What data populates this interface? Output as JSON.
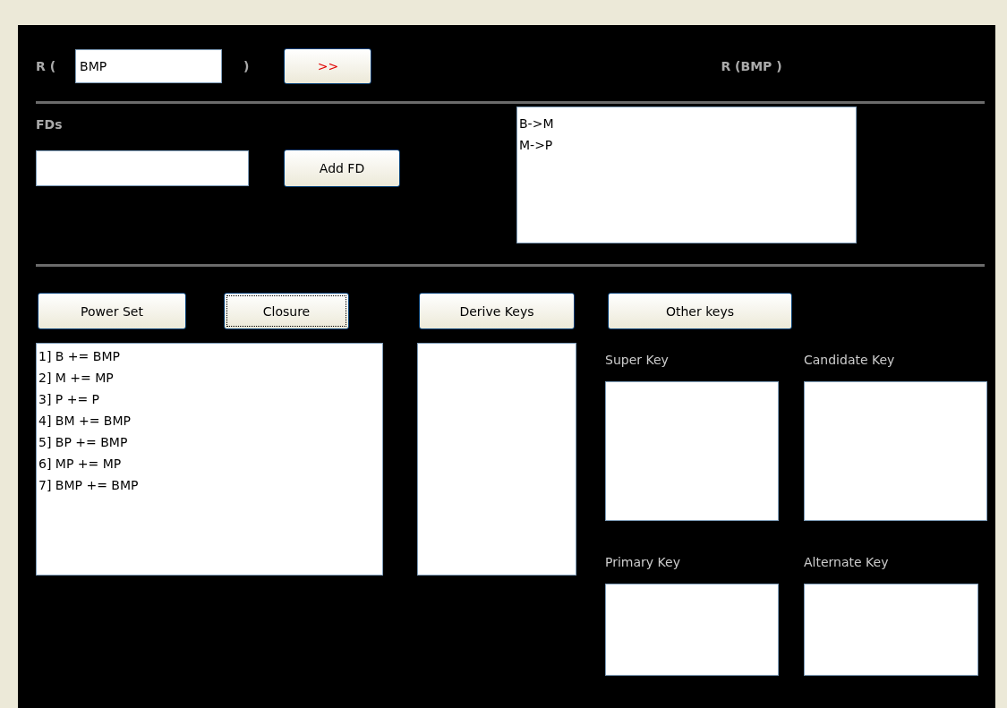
{
  "relation": {
    "prefix": "R (",
    "value": "BMP",
    "suffix": ")",
    "go_button": ">>",
    "result": "R (BMP )"
  },
  "fds": {
    "label": "FDs",
    "add_button": "Add FD",
    "list": [
      "B->M",
      "M->P"
    ]
  },
  "actions": [
    {
      "label": "Power Set",
      "focused": false
    },
    {
      "label": "Closure",
      "focused": true
    }
  ],
  "closure_list": [
    "1] B += BMP",
    "2] M += MP",
    "3] P += P",
    "4] BM += BMP",
    "5] BP += BMP",
    "6] MP += MP",
    "7] BMP += BMP"
  ],
  "derive": {
    "button": "Derive Keys",
    "focused": false
  },
  "other": {
    "button": "Other keys",
    "focused": false,
    "boxes": [
      {
        "label": "Super Key"
      },
      {
        "label": "Candidate Key"
      },
      {
        "label": "Primary Key"
      },
      {
        "label": "Alternate Key"
      }
    ]
  }
}
